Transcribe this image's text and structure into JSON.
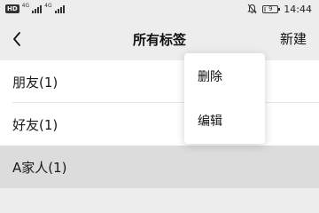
{
  "status_bar": {
    "hd_badge": "HD",
    "net1": "4G",
    "net2": "4G",
    "battery_level": "9",
    "battery_fraction": 0.09,
    "time": "14:44"
  },
  "header": {
    "title": "所有标签",
    "new_label": "新建"
  },
  "tags": [
    {
      "label": "朋友(1)"
    },
    {
      "label": "好友(1)"
    },
    {
      "label": "A家人(1)"
    }
  ],
  "popup_menu": {
    "items": [
      {
        "label": "删除"
      },
      {
        "label": "编辑"
      }
    ]
  },
  "colors": {
    "background": "#ededed",
    "list_bg": "#ffffff",
    "selected_row": "#dcdcdc",
    "text": "#1a1a1a"
  }
}
